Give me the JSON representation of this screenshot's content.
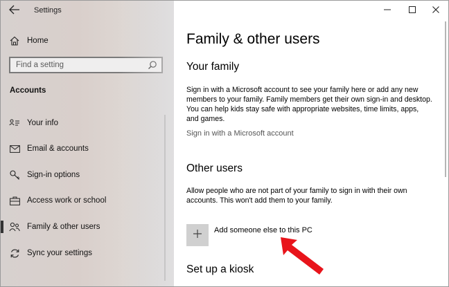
{
  "window": {
    "title": "Settings",
    "controls": [
      "minimize-icon",
      "maximize-icon",
      "close-icon"
    ]
  },
  "sidebar": {
    "home_label": "Home",
    "search_placeholder": "Find a setting",
    "section_title": "Accounts",
    "items": [
      {
        "label": "Your info",
        "icon": "person-card-icon"
      },
      {
        "label": "Email & accounts",
        "icon": "mail-icon"
      },
      {
        "label": "Sign-in options",
        "icon": "key-icon"
      },
      {
        "label": "Access work or school",
        "icon": "briefcase-icon"
      },
      {
        "label": "Family & other users",
        "icon": "people-icon",
        "selected": true
      },
      {
        "label": "Sync your settings",
        "icon": "sync-icon"
      }
    ]
  },
  "main": {
    "page_title": "Family & other users",
    "your_family": {
      "heading": "Your family",
      "description": "Sign in with a Microsoft account to see your family here or add any new members to your family. Family members get their own sign-in and desktop. You can help kids stay safe with appropriate websites, time limits, apps, and games.",
      "link": "Sign in with a Microsoft account"
    },
    "other_users": {
      "heading": "Other users",
      "description": "Allow people who are not part of your family to sign in with their own accounts. This won't add them to your family.",
      "add_label": "Add someone else to this PC"
    },
    "kiosk": {
      "heading": "Set up a kiosk"
    }
  },
  "colors": {
    "annotation_arrow": "#e8141b",
    "add_tile": "#d0d0d0"
  }
}
